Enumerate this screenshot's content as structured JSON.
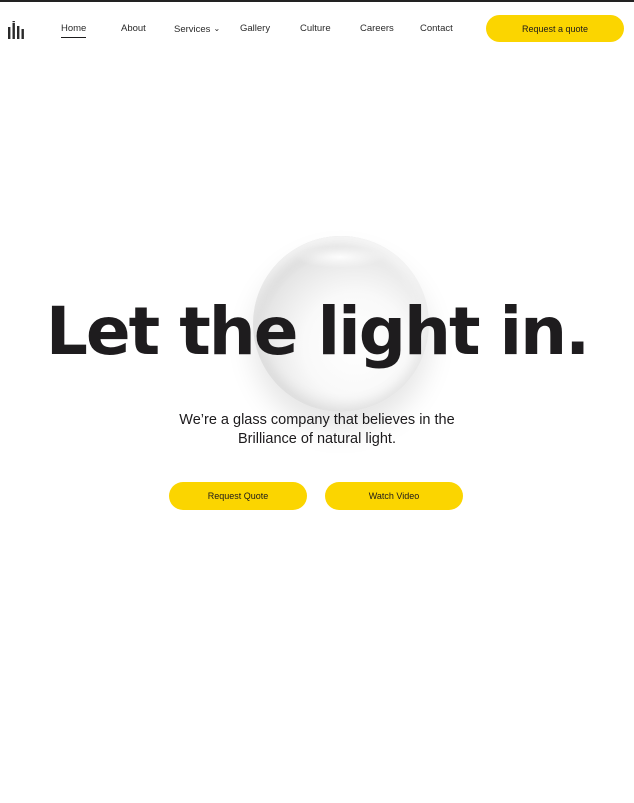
{
  "brand": {
    "logo_icon": "building-columns-logo"
  },
  "nav": {
    "items": [
      {
        "label": "Home",
        "active": true
      },
      {
        "label": "About"
      },
      {
        "label": "Services",
        "has_dropdown": true
      },
      {
        "label": "Gallery"
      },
      {
        "label": "Culture"
      },
      {
        "label": "Careers"
      },
      {
        "label": "Contact"
      }
    ],
    "cta_label": "Request a quote"
  },
  "hero": {
    "headline": "Let the light in.",
    "subtitle_line1": "We’re a glass company that believes in the",
    "subtitle_line2": "Brilliance of natural light.",
    "primary_button": "Request Quote",
    "secondary_button": "Watch Video"
  },
  "colors": {
    "accent": "#fbd500",
    "text": "#1c1a1c",
    "background": "#ffffff"
  }
}
